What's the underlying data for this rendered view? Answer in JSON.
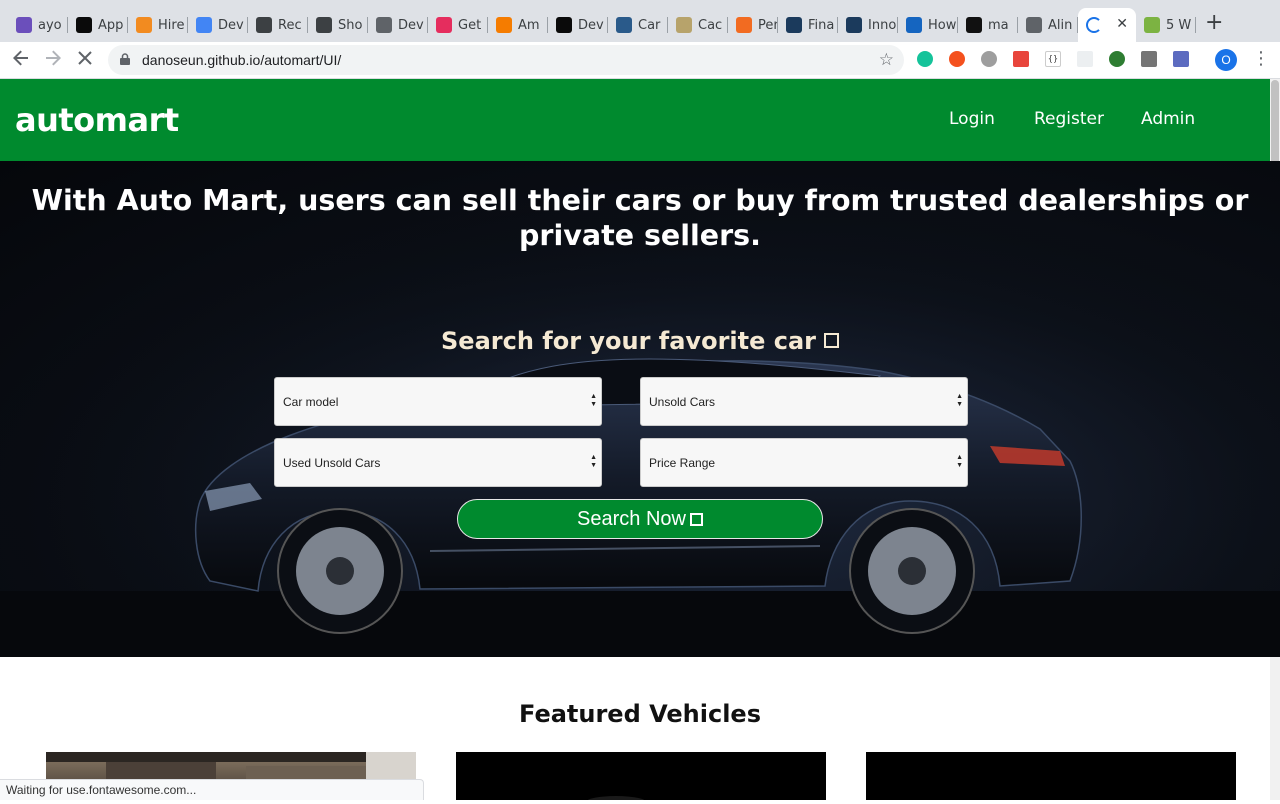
{
  "browser": {
    "tabs": [
      {
        "label": "ayo",
        "icon": "mail-icon",
        "color": "#6b4fbb"
      },
      {
        "label": "App",
        "icon": "dev-icon",
        "color": "#0a0a0a"
      },
      {
        "label": "Hire",
        "icon": "star-icon",
        "color": "#f28b20"
      },
      {
        "label": "Dev",
        "icon": "docs-icon",
        "color": "#4285f4"
      },
      {
        "label": "Rec",
        "icon": "list-icon",
        "color": "#3c4043"
      },
      {
        "label": "Sho",
        "icon": "pen-icon",
        "color": "#3c4043"
      },
      {
        "label": "Dev",
        "icon": "globe-icon",
        "color": "#5f6368"
      },
      {
        "label": "Get",
        "icon": "play-icon",
        "color": "#e52d5e"
      },
      {
        "label": "Am",
        "icon": "box-icon",
        "color": "#f57c00"
      },
      {
        "label": "Dev",
        "icon": "dev-icon",
        "color": "#0a0a0a"
      },
      {
        "label": "Car",
        "icon": "image-icon",
        "color": "#2a5a8a"
      },
      {
        "label": "Cac",
        "icon": "food-icon",
        "color": "#b7a36b"
      },
      {
        "label": "Per",
        "icon": "s-icon",
        "color": "#f26b21"
      },
      {
        "label": "Fina",
        "icon": "fsi-icon",
        "color": "#1b3a5c"
      },
      {
        "label": "Inno",
        "icon": "fsi-icon",
        "color": "#1b3a5c"
      },
      {
        "label": "How",
        "icon": "b-icon",
        "color": "#1565c0"
      },
      {
        "label": "ma",
        "icon": "github-icon",
        "color": "#111111"
      },
      {
        "label": "Alin",
        "icon": "globe-icon",
        "color": "#5f6368"
      },
      {
        "label": "",
        "icon": "loading-icon",
        "color": "#1a73e8"
      },
      {
        "label": "5 W",
        "icon": "wh-icon",
        "color": "#7cb342"
      }
    ],
    "active_tab_close": "✕",
    "new_tab": "+",
    "url": "danoseun.github.io/automart/UI/",
    "profile_initial": "O",
    "status_text": "Waiting for use.fontawesome.com..."
  },
  "header": {
    "logo": "automart",
    "nav": [
      "Login",
      "Register",
      "Admin"
    ]
  },
  "hero": {
    "title": "With Auto Mart, users can sell their cars or buy from trusted dealerships or private sellers.",
    "search_title": "Search for your favorite car",
    "selects": {
      "car_model": "Car model",
      "unsold_cars": "Unsold Cars",
      "used_unsold": "Used Unsold Cars",
      "price_range": "Price Range"
    },
    "search_button": "Search Now"
  },
  "featured": {
    "title": "Featured Vehicles"
  },
  "colors": {
    "brand_green": "#008a2e",
    "hero_text": "#ffffff",
    "search_title": "#f5e9d3"
  }
}
